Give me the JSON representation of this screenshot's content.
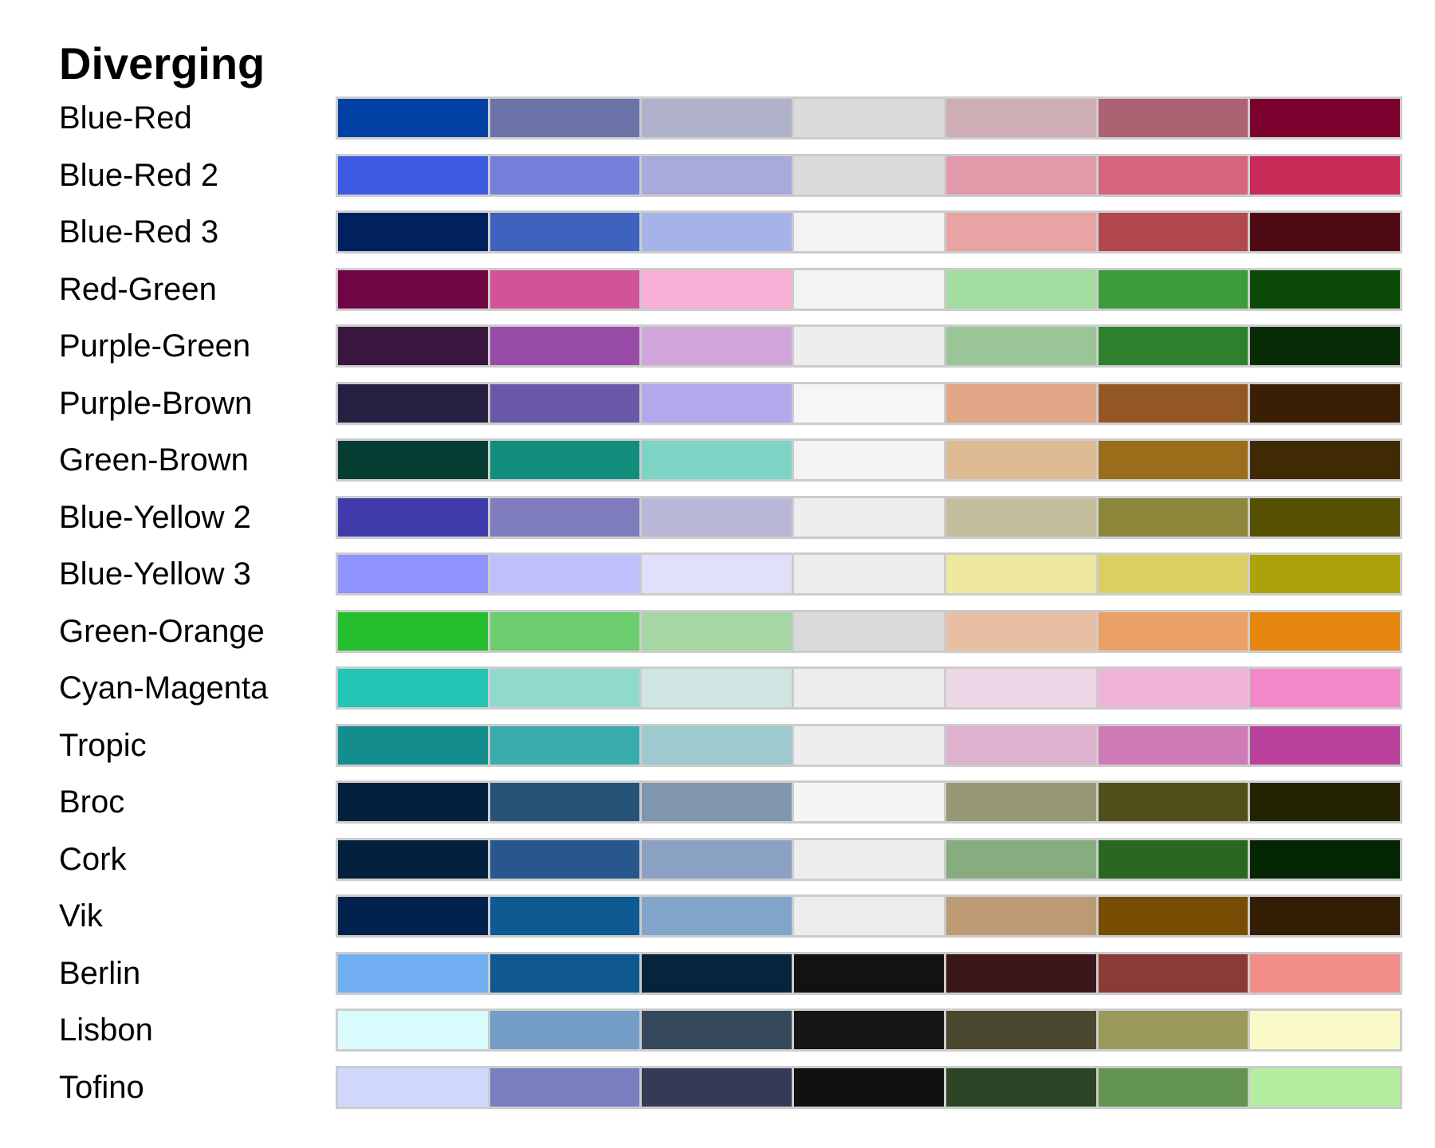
{
  "chart_data": {
    "type": "table",
    "title": "Diverging",
    "palettes": [
      {
        "name": "Blue-Red",
        "colors": [
          "#023FA5",
          "#6A72A8",
          "#B0B2CB",
          "#DBDBDB",
          "#CEADB4",
          "#AC6273",
          "#7C002E"
        ]
      },
      {
        "name": "Blue-Red 2",
        "colors": [
          "#3D5AE2",
          "#767FDA",
          "#A7AADD",
          "#DADADA",
          "#E09AAA",
          "#D7647D",
          "#C92A57"
        ]
      },
      {
        "name": "Blue-Red 3",
        "colors": [
          "#00205E",
          "#4062BF",
          "#A6B3E8",
          "#F3F3F3",
          "#E8A3A5",
          "#B2474C",
          "#4E0B13"
        ]
      },
      {
        "name": "Red-Green",
        "colors": [
          "#6F0543",
          "#D35496",
          "#F9B0D7",
          "#F3F3F3",
          "#A2DC9F",
          "#3C9B3A",
          "#0B4A06"
        ]
      },
      {
        "name": "Purple-Green",
        "colors": [
          "#3A153E",
          "#974AA6",
          "#D1A7DB",
          "#EEEEEE",
          "#9AC697",
          "#2D802C",
          "#082C06"
        ]
      },
      {
        "name": "Purple-Brown",
        "colors": [
          "#271F42",
          "#6958A7",
          "#B3A8EB",
          "#F6F6F6",
          "#E0A685",
          "#935625",
          "#3B1F04"
        ]
      },
      {
        "name": "Green-Brown",
        "colors": [
          "#043C32",
          "#118E7B",
          "#7DD3C4",
          "#F3F3F3",
          "#DEBA92",
          "#9B6C1A",
          "#402A03"
        ]
      },
      {
        "name": "Blue-Yellow 2",
        "colors": [
          "#403BAB",
          "#7F7DBD",
          "#B9B7D8",
          "#EDEDED",
          "#C4BE9D",
          "#8E873B",
          "#565000"
        ]
      },
      {
        "name": "Blue-Yellow 3",
        "colors": [
          "#8F94FF",
          "#BFC0FB",
          "#E0E0FA",
          "#EDEDED",
          "#EFE89F",
          "#DAD062",
          "#AEA20B"
        ]
      },
      {
        "name": "Green-Orange",
        "colors": [
          "#23BE2C",
          "#6CCD6F",
          "#A5D6A3",
          "#DADADA",
          "#E8BFA3",
          "#EBA166",
          "#E6860F"
        ]
      },
      {
        "name": "Cyan-Magenta",
        "colors": [
          "#21C7B4",
          "#8FD9CD",
          "#CEE5E2",
          "#EDEDED",
          "#EDD7E6",
          "#EFB4D7",
          "#F388C9"
        ]
      },
      {
        "name": "Tropic",
        "colors": [
          "#138D8E",
          "#39ADAD",
          "#9DCACE",
          "#EDEDED",
          "#DEB1CE",
          "#CD7AB5",
          "#BB429C"
        ]
      },
      {
        "name": "Broc",
        "colors": [
          "#03203C",
          "#275378",
          "#8196AF",
          "#F5F5F5",
          "#999875",
          "#51501A",
          "#232201"
        ]
      },
      {
        "name": "Cork",
        "colors": [
          "#03203F",
          "#28578D",
          "#8BA1C4",
          "#EDEDED",
          "#86AC7F",
          "#2A6721",
          "#032501"
        ]
      },
      {
        "name": "Vik",
        "colors": [
          "#02224E",
          "#0E5A93",
          "#81A4CB",
          "#EDEDED",
          "#BC9B74",
          "#764D02",
          "#331D03"
        ]
      },
      {
        "name": "Berlin",
        "colors": [
          "#71AFF2",
          "#0F5990",
          "#06243B",
          "#121212",
          "#3C1719",
          "#8C3A36",
          "#F28C88"
        ]
      },
      {
        "name": "Lisbon",
        "colors": [
          "#DAFBFE",
          "#739CC6",
          "#36495C",
          "#161616",
          "#49472D",
          "#9B9A5B",
          "#FAFAC8"
        ]
      },
      {
        "name": "Tofino",
        "colors": [
          "#D0D9FD",
          "#797EBE",
          "#353A56",
          "#111111",
          "#2D4526",
          "#63944F",
          "#B5EDA1"
        ]
      }
    ]
  }
}
